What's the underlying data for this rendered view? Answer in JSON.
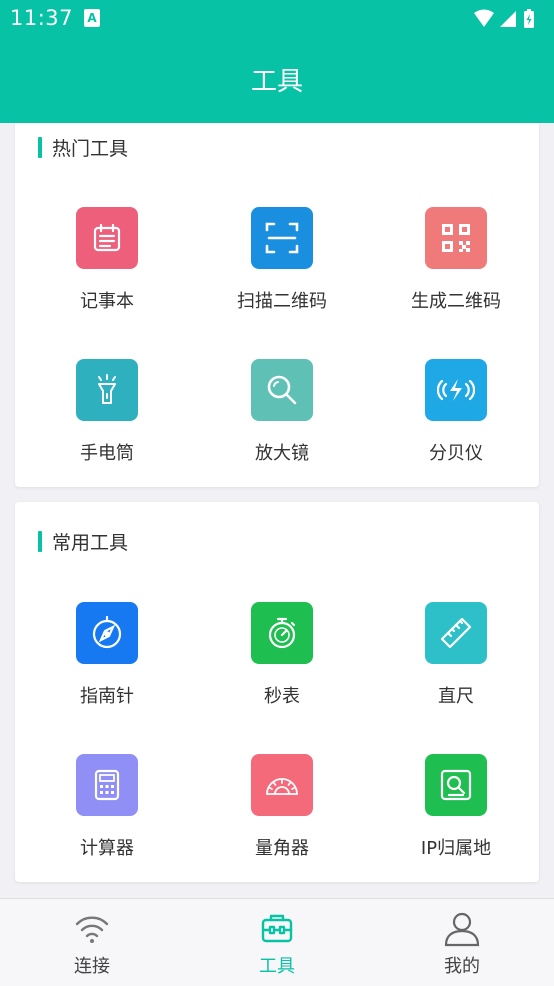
{
  "status_bar": {
    "time": "11:37",
    "notification_badge": "A"
  },
  "header": {
    "title": "工具",
    "bg_color": "#08c2a6"
  },
  "sections": [
    {
      "title": "热门工具",
      "tools": [
        {
          "label": "记事本",
          "icon": "notepad-icon",
          "color": "#ee5f7b"
        },
        {
          "label": "扫描二维码",
          "icon": "scan-qr-icon",
          "color": "#1a8fe0"
        },
        {
          "label": "生成二维码",
          "icon": "qr-code-icon",
          "color": "#f07a7a"
        },
        {
          "label": "手电筒",
          "icon": "flashlight-icon",
          "color": "#2eb0bf"
        },
        {
          "label": "放大镜",
          "icon": "magnifier-icon",
          "color": "#5fc0b6"
        },
        {
          "label": "分贝仪",
          "icon": "decibel-meter-icon",
          "color": "#1fa8e6"
        }
      ]
    },
    {
      "title": "常用工具",
      "tools": [
        {
          "label": "指南针",
          "icon": "compass-icon",
          "color": "#1679f2"
        },
        {
          "label": "秒表",
          "icon": "stopwatch-icon",
          "color": "#1ebe50"
        },
        {
          "label": "直尺",
          "icon": "ruler-icon",
          "color": "#2ec0c8"
        },
        {
          "label": "计算器",
          "icon": "calculator-icon",
          "color": "#8f8ff5"
        },
        {
          "label": "量角器",
          "icon": "protractor-icon",
          "color": "#f46a7a"
        },
        {
          "label": "IP归属地",
          "icon": "ip-lookup-icon",
          "color": "#1ebe50"
        }
      ]
    }
  ],
  "tab_bar": {
    "tabs": [
      {
        "label": "连接",
        "icon": "wifi-icon",
        "active": false
      },
      {
        "label": "工具",
        "icon": "toolbox-icon",
        "active": true
      },
      {
        "label": "我的",
        "icon": "profile-icon",
        "active": false
      }
    ],
    "active_color": "#08c2a6",
    "inactive_color": "#444444"
  }
}
